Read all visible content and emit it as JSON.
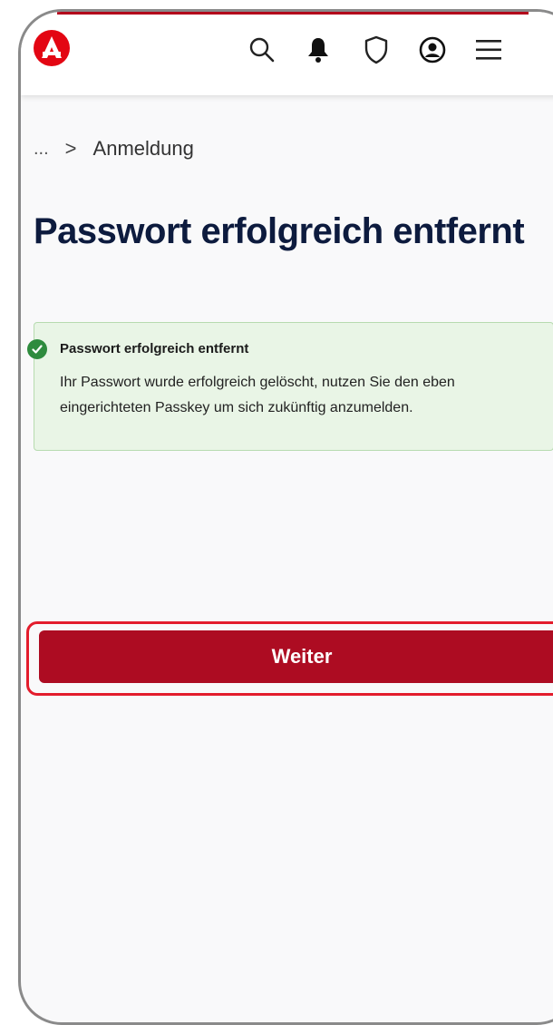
{
  "header": {
    "icons": [
      "logo-icon",
      "search-icon",
      "bell-icon",
      "shield-icon",
      "account-icon",
      "menu-icon"
    ]
  },
  "breadcrumb": {
    "ellipsis": "...",
    "separator": ">",
    "current": "Anmeldung"
  },
  "page": {
    "title": "Passwort erfolgreich entfernt"
  },
  "alert": {
    "title": "Passwort erfolgreich entfernt",
    "body": "Ihr Passwort wurde erfolgreich gelöscht, nutzen Sie den eben eingerichteten Passkey um sich zukünftig anzumelden."
  },
  "actions": {
    "continue_label": "Weiter"
  },
  "colors": {
    "brand_red": "#ad0c22",
    "highlight_red": "#e31c2c",
    "success_green": "#2e8b3e",
    "alert_bg": "#e9f5e6",
    "title_navy": "#0d1b3e"
  }
}
